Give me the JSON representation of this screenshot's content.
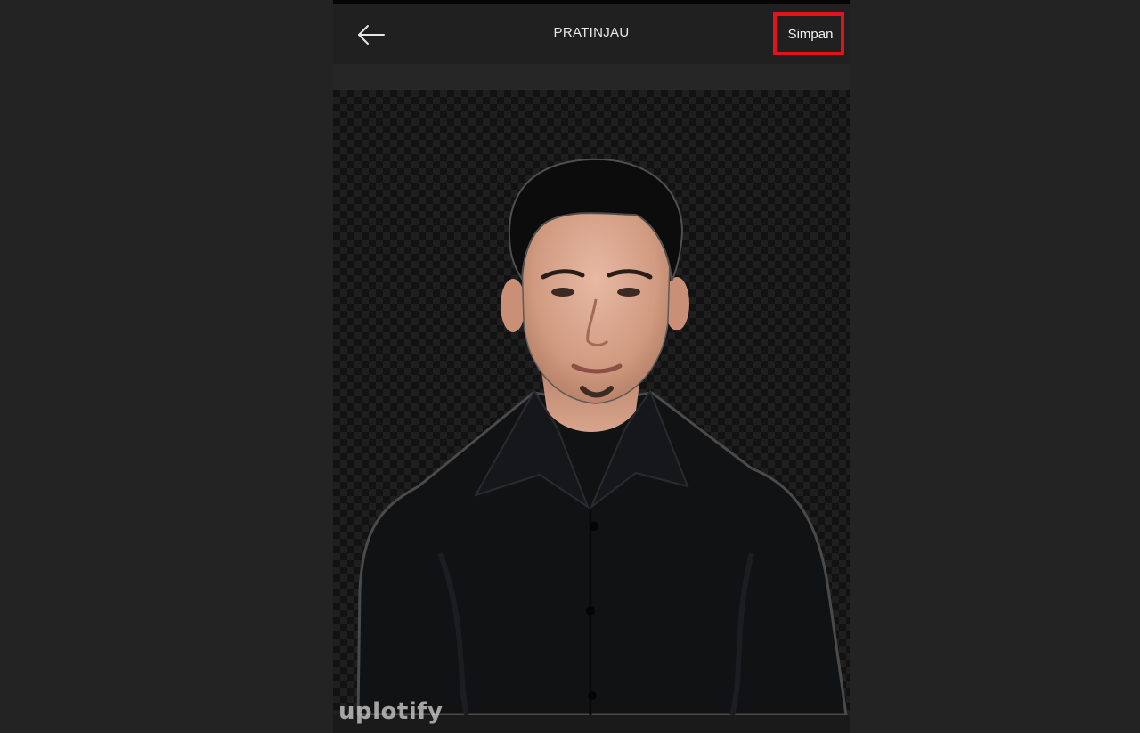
{
  "header": {
    "title": "PRATINJAU",
    "save_label": "Simpan",
    "back_icon": "arrow-left-icon"
  },
  "preview": {
    "subject": "person-cutout-photo",
    "background": "transparent-checkerboard"
  },
  "watermark": {
    "text": "uplotify"
  },
  "colors": {
    "highlight": "#e0141a",
    "app_bar": "#202020",
    "outer_background": "#232323"
  }
}
